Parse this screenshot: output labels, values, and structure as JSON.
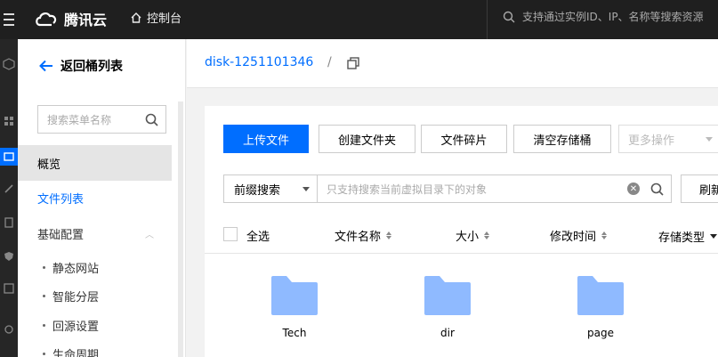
{
  "topbar": {
    "brand": "腾讯云",
    "console_label": "控制台",
    "search_placeholder": "支持通过实例ID、IP、名称等搜索资源"
  },
  "sidebar": {
    "back_label": "返回桶列表",
    "search_placeholder": "搜索菜单名称",
    "items": [
      {
        "label": "概览"
      },
      {
        "label": "文件列表"
      },
      {
        "label": "基础配置"
      }
    ],
    "sub_items": [
      {
        "label": "静态网站"
      },
      {
        "label": "智能分层"
      },
      {
        "label": "回源设置"
      },
      {
        "label": "生命周期"
      }
    ]
  },
  "breadcrumb": {
    "bucket": "disk-1251101346",
    "separator": "/"
  },
  "toolbar": {
    "upload": "上传文件",
    "create_folder": "创建文件夹",
    "fragments": "文件碎片",
    "empty_bucket": "清空存储桶",
    "more_ops": "更多操作"
  },
  "filter": {
    "prefix_search": "前缀搜索",
    "placeholder": "只支持搜索当前虚拟目录下的对象",
    "refresh": "刷新"
  },
  "table": {
    "select_all": "全选",
    "columns": [
      "文件名称",
      "大小",
      "修改时间",
      "存储类型"
    ]
  },
  "folders": [
    {
      "name": "Tech"
    },
    {
      "name": "dir"
    },
    {
      "name": "page"
    }
  ],
  "colors": {
    "accent": "#006eff",
    "folder": "#8fbaff",
    "topbar": "#1f1f1f"
  }
}
